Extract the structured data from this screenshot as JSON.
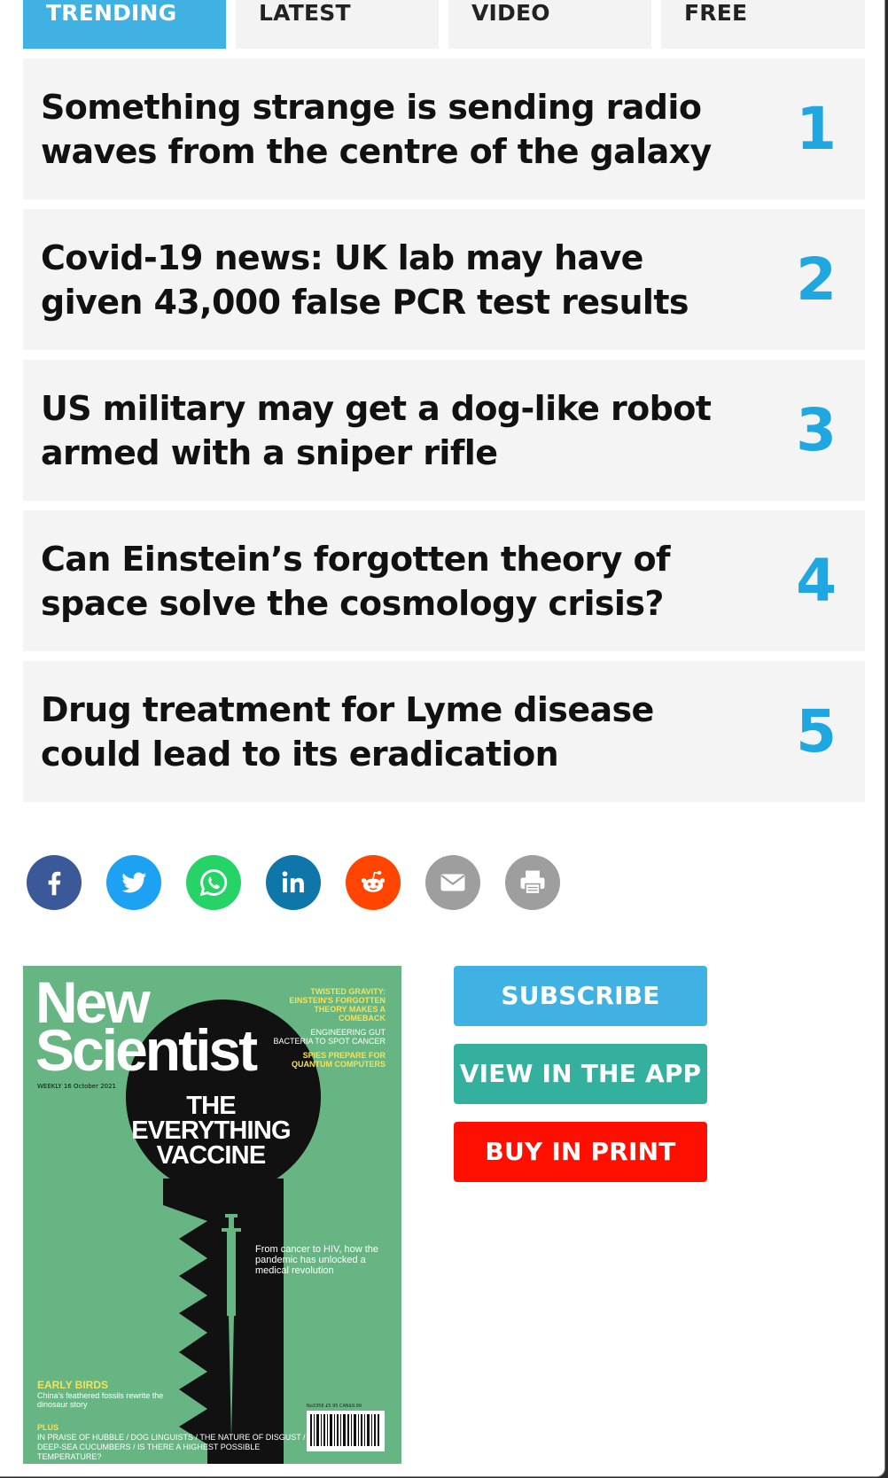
{
  "tabs": [
    {
      "label": "TRENDING",
      "active": true
    },
    {
      "label": "LATEST",
      "active": false
    },
    {
      "label": "VIDEO",
      "active": false
    },
    {
      "label": "FREE",
      "active": false
    }
  ],
  "trending": [
    {
      "title": "Something strange is sending radio waves from the centre of the galaxy",
      "rank": "1"
    },
    {
      "title": "Covid-19 news: UK lab may have given 43,000 false PCR test results",
      "rank": "2"
    },
    {
      "title": "US military may get a dog-like robot armed with a sniper rifle",
      "rank": "3"
    },
    {
      "title": "Can Einstein’s forgotten theory of space solve the cosmology crisis?",
      "rank": "4"
    },
    {
      "title": "Drug treatment for Lyme disease could lead to its eradication",
      "rank": "5"
    }
  ],
  "share": [
    {
      "name": "facebook",
      "color": "#3b5998"
    },
    {
      "name": "twitter",
      "color": "#1da1f2"
    },
    {
      "name": "whatsapp",
      "color": "#25d366"
    },
    {
      "name": "linkedin",
      "color": "#0e76a8"
    },
    {
      "name": "reddit",
      "color": "#ff4500"
    },
    {
      "name": "email",
      "color": "#9e9e9e"
    },
    {
      "name": "print",
      "color": "#9e9e9e"
    }
  ],
  "cover": {
    "brand_line1": "New",
    "brand_line2": "Scientist",
    "weekly": "WEEKLY 16 October 2021",
    "headline": "THE EVERYTHING VACCINE",
    "blurb1": "TWISTED GRAVITY: EINSTEIN'S FORGOTTEN THEORY MAKES A COMEBACK",
    "blurb2": "ENGINEERING GUT BACTERIA TO SPOT CANCER",
    "blurb3": "SPIES PREPARE FOR QUANTUM COMPUTERS",
    "pandemic": "From cancer to HIV, how the pandemic has unlocked a medical revolution",
    "early_title": "EARLY BIRDS",
    "early_text": "China's feathered fossils rewrite the dinosaur story",
    "plus_label": "PLUS",
    "plus_line1": "IN PRAISE OF HUBBLE / DOG LINGUISTS / THE NATURE OF DISGUST /",
    "plus_line2": "DEEP-SEA CUCUMBERS / IS THERE A HIGHEST POSSIBLE TEMPERATURE?",
    "price": "No3356 £5.95 CAN$9.99"
  },
  "buttons": {
    "subscribe": "SUBSCRIBE",
    "app": "VIEW IN THE APP",
    "print": "BUY IN PRINT"
  }
}
